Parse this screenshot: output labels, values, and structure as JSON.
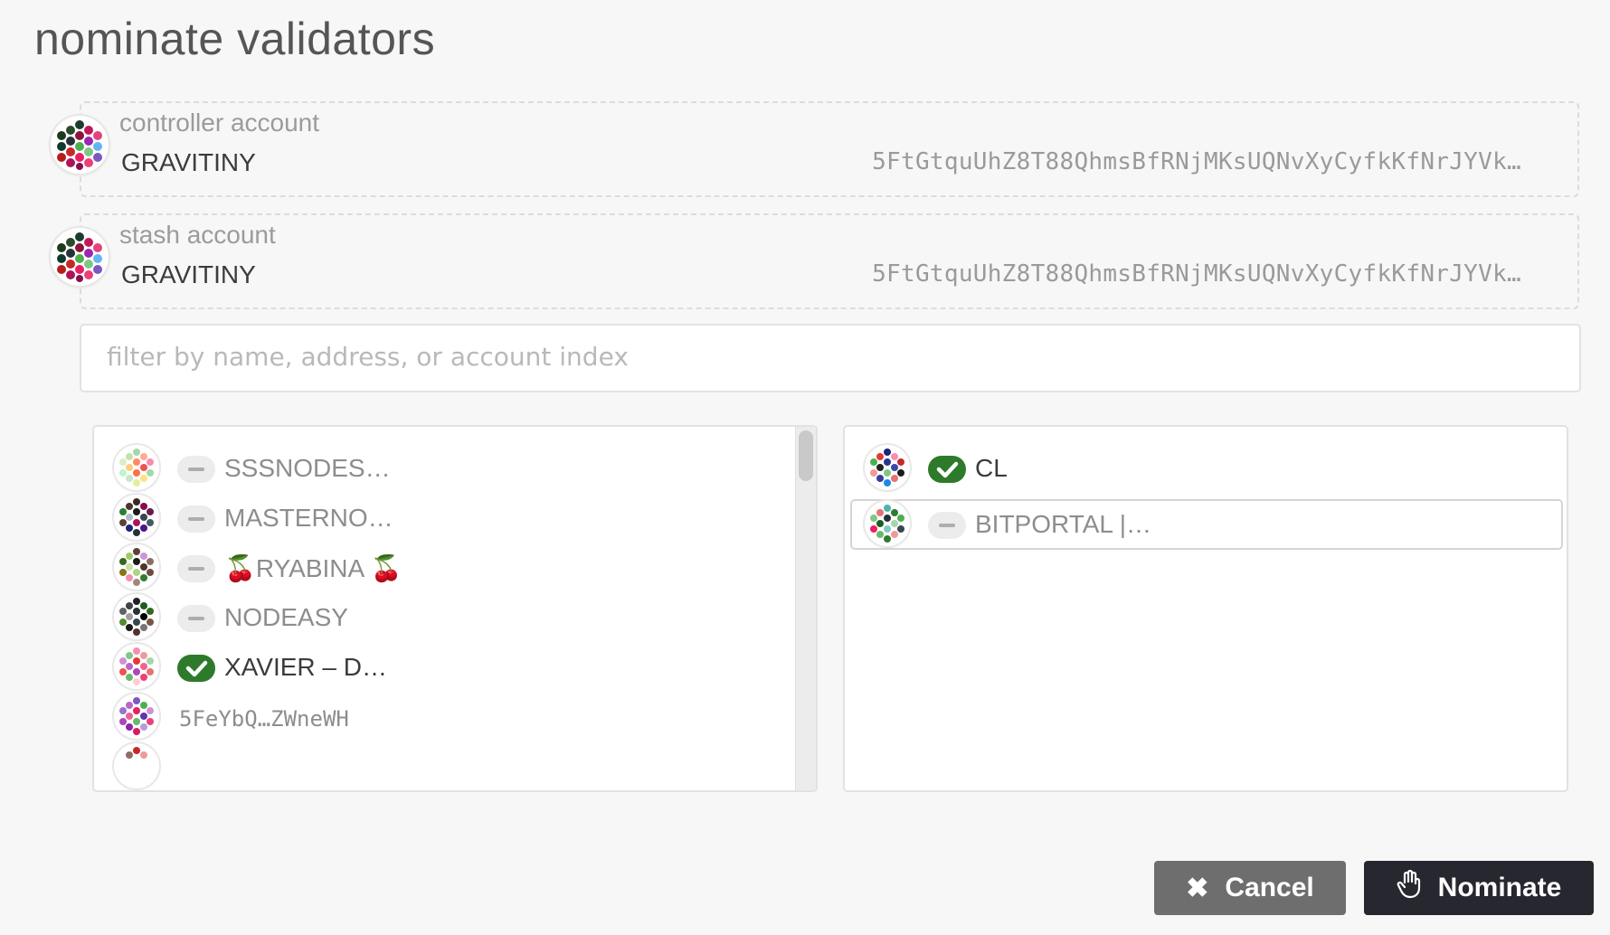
{
  "page": {
    "title": "nominate validators"
  },
  "controller": {
    "label": "controller account",
    "name": "GRAVITINY",
    "address": "5FtGtquUhZ8T88QhmsBfRNjMKsUQNvXyCyfkKfNrJYVk…"
  },
  "stash": {
    "label": "stash account",
    "name": "GRAVITINY",
    "address": "5FtGtquUhZ8T88QhmsBfRNjMKsUQNvXyCyfkKfNrJYVk…"
  },
  "search": {
    "placeholder": "filter by name, address, or account index"
  },
  "available": {
    "items": [
      {
        "label": "SSSNODES…",
        "state": "dash"
      },
      {
        "label": "MASTERNO…",
        "state": "dash"
      },
      {
        "label": "🍒RYABINA 🍒",
        "state": "dash"
      },
      {
        "label": "NODEASY",
        "state": "dash"
      },
      {
        "label": "XAVIER – D…",
        "state": "check"
      },
      {
        "label": "5FeYbQ…ZWneWH",
        "state": "none"
      }
    ]
  },
  "selected": {
    "items": [
      {
        "label": "CL",
        "state": "check"
      },
      {
        "label": "BITPORTAL |…",
        "state": "dash"
      }
    ]
  },
  "buttons": {
    "cancel": "Cancel",
    "nominate": "Nominate"
  },
  "icons": {
    "cancel": "close-icon",
    "nominate": "hand-icon",
    "check": "check-icon",
    "identicon": "identicon"
  },
  "colors": {
    "check": "#2d7a2b",
    "nominate_bg": "#272730",
    "cancel_bg": "#6e6e6e"
  }
}
